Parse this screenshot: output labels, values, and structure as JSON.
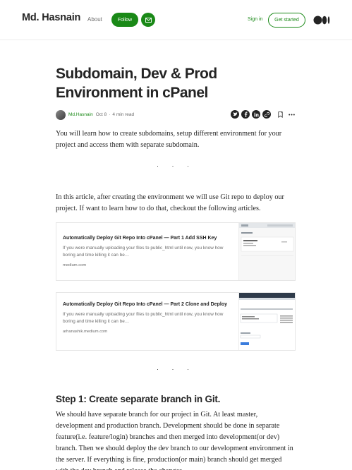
{
  "header": {
    "brand": "Md. Hasnain",
    "about_label": "About",
    "follow_label": "Follow",
    "signin_label": "Sign in",
    "get_started_label": "Get started"
  },
  "article": {
    "title": "Subdomain, Dev & Prod Environment in cPanel",
    "author": "Md.Hasnain",
    "date": "Oct 8",
    "meta_separator": "·",
    "read_time": "4 min read",
    "share_icons": [
      "twitter-icon",
      "facebook-icon",
      "linkedin-icon",
      "link-icon"
    ],
    "intro": "You will learn how to create subdomains, setup different environment for your project and access them with separate subdomain.",
    "separator": "· · ·",
    "para2": "In this article, after creating the environment we will use Git repo to deploy our project. If want to learn how to do that, checkout the following articles.",
    "cards": [
      {
        "title": "Automatically Deploy Git Repo Into cPanel — Part 1 Add SSH Key",
        "desc": "If you were manually uploading your files to public_html until now, you know how boring and time killing it can be…",
        "domain": "medium.com"
      },
      {
        "title": "Automatically Deploy Git Repo Into cPanel — Part 2 Clone and Deploy",
        "desc": "If you were manually uploading your files to public_html until now, you know how boring and time killing it can be…",
        "domain": "arhanashik.medium.com"
      }
    ],
    "step1_heading": "Step 1: Create separate branch in Git.",
    "step1_body": "We should have separate branch for our project in Git. At least master, development and production branch. Development should be done in separate feature(i.e. feature/login) branches and then merged into development(or dev) branch. Then we should deploy the dev branch to our development environment in the server. If everything is fine, production(or main) branch should get merged with the dev branch and release the changes."
  },
  "colors": {
    "accent": "#1a8917",
    "text": "#242424",
    "muted": "#6b6b6b"
  }
}
